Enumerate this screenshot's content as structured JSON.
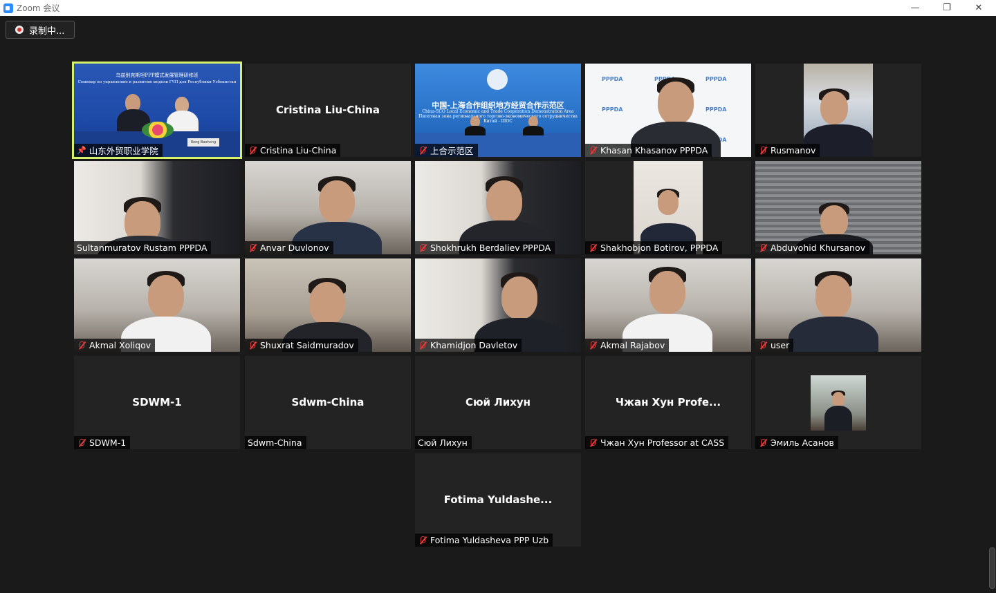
{
  "window": {
    "title": "Zoom 会议",
    "minimize": "—",
    "maximize": "❐",
    "close": "✕"
  },
  "recording": {
    "label": "录制中..."
  },
  "participants": [
    {
      "name": "山东外贸职业学院",
      "muted": false,
      "pinned": true,
      "active": true,
      "video": "conference"
    },
    {
      "name": "Cristina Liu-China",
      "display": "Cristina Liu-China",
      "muted": true,
      "video": "none"
    },
    {
      "name": "上合示范区",
      "muted": true,
      "video": "banner",
      "banner": {
        "cn": "中国-上海合作组织地方经贸合作示范区",
        "en": "China-SCO Local Economic and Trade Cooperation Demonstration Area",
        "ru": "Пилотная зона регионального торгово-экономического сотрудничества Китай - ШОС"
      }
    },
    {
      "name": "Khasan Khasanov  PPPDA",
      "muted": true,
      "video": "pppda"
    },
    {
      "name": "Rusmanov",
      "muted": true,
      "video": "window"
    },
    {
      "name": "Sultanmuratov Rustam PPPDA",
      "muted": false,
      "video": "shelf"
    },
    {
      "name": "Anvar Duvlonov",
      "muted": true,
      "video": "office"
    },
    {
      "name": "Shokhrukh Berdaliev PPPDA",
      "muted": true,
      "video": "shelf"
    },
    {
      "name": "Shakhobjon Botirov, PPPDA",
      "muted": true,
      "video": "portrait"
    },
    {
      "name": "Abduvohid Khursanov",
      "muted": true,
      "video": "blinds"
    },
    {
      "name": "Akmal Xoliqov",
      "muted": true,
      "video": "office"
    },
    {
      "name": "Shuxrat Saidmuradov",
      "muted": true,
      "video": "room"
    },
    {
      "name": "Khamidjon Davletov",
      "muted": true,
      "video": "shelf"
    },
    {
      "name": "Akmal Rajabov",
      "muted": true,
      "video": "office"
    },
    {
      "name": "user",
      "muted": true,
      "video": "office"
    },
    {
      "name": "SDWM-1",
      "display": "SDWM-1",
      "muted": true,
      "video": "none"
    },
    {
      "name": "Sdwm-China",
      "display": "Sdwm-China",
      "muted": false,
      "video": "none"
    },
    {
      "name": "Сюй Лихун",
      "display": "Сюй Лихун",
      "muted": false,
      "video": "none"
    },
    {
      "name": "Чжан Хун Professor at CASS",
      "display": "Чжан Хун Profe...",
      "muted": true,
      "video": "none"
    },
    {
      "name": "Эмиль Асанов",
      "muted": true,
      "video": "avatar"
    },
    {
      "name": "Fotima Yuldasheva PPP Uzb",
      "display": "Fotima  Yuldashe...",
      "muted": true,
      "video": "none"
    }
  ],
  "conference_slide": {
    "line1": "乌兹别克斯坦PPP模式发展管理研修班",
    "line2": "Семинар по управлению и развитию модели ГЧП для Республики Узбекистан",
    "nameplate": "Rong Baohong"
  },
  "pppda_logo": "PPPDA"
}
